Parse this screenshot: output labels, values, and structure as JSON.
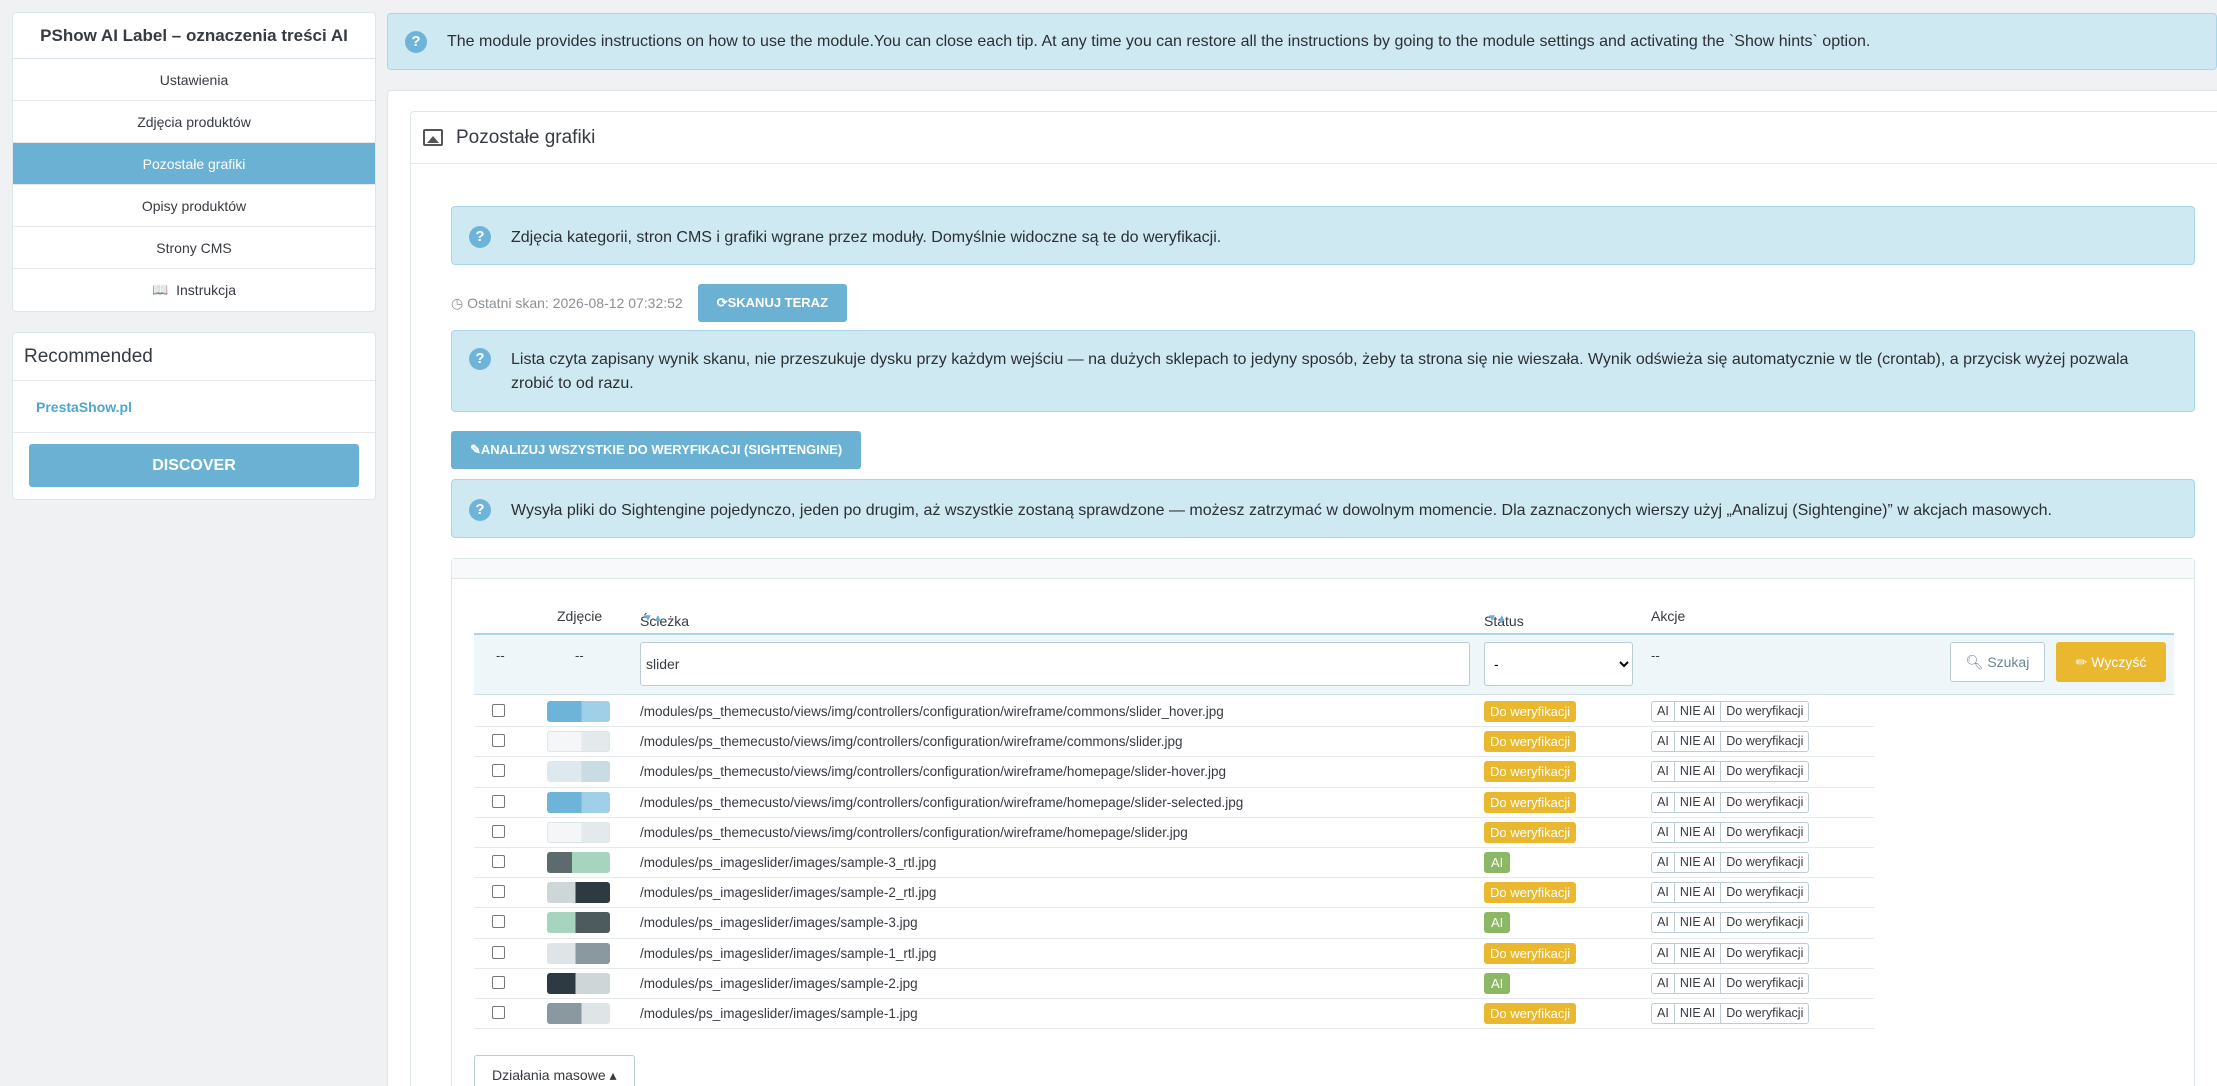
{
  "sidebar": {
    "title": "PShow AI Label – oznaczenia treści AI",
    "items": [
      {
        "label": "Ustawienia"
      },
      {
        "label": "Zdjęcia produktów"
      },
      {
        "label": "Pozostałe grafiki"
      },
      {
        "label": "Opisy produktów"
      },
      {
        "label": "Strony CMS"
      },
      {
        "label": "Instrukcja"
      }
    ],
    "active": "Pozostałe grafiki",
    "recommended_title": "Recommended",
    "recommended_link": "PrestaShow.pl",
    "discover_label": "DISCOVER"
  },
  "top_tip": "The module provides instructions on how to use the module.You can close each tip. At any time you can restore all the instructions by going to the module settings and activating the `Show hints` option.",
  "panel": {
    "title": "Pozostałe grafiki",
    "tip1": "Zdjęcia kategorii, stron CMS i grafiki wgrane przez moduły. Domyślnie widoczne są te do weryfikacji.",
    "last_scan": "Ostatni skan: 2026-08-12 07:32:52",
    "scan_button": "SKANUJ TERAZ",
    "tip2": "Lista czyta zapisany wynik skanu, nie przeszukuje dysku przy każdym wejściu — na dużych sklepach to jedyny sposób, żeby ta strona się nie wieszała. Wynik odświeża się automatycznie w tle (crontab), a przycisk wyżej pozwala zrobić to od razu.",
    "analyze_button": "ANALIZUJ WSZYSTKIE DO WERYFIKACJI (SIGHTENGINE)",
    "tip3": "Wysyła pliki do Sightengine pojedynczo, jeden po drugim, aż wszystkie zostaną sprawdzone — możesz zatrzymać w dowolnym momencie. Dla zaznaczonych wierszy użyj „Analizuj (Sightengine)” w akcjach masowych."
  },
  "table": {
    "headers": {
      "photo": "Zdjęcie",
      "path": "Ścieżka",
      "status": "Status",
      "actions": "Akcje"
    },
    "filter": {
      "dash1": "--",
      "dash2": "--",
      "path_value": "slider",
      "status_value": "-",
      "actions_dash": "--",
      "search_label": "Szukaj",
      "clear_label": "Wyczyść"
    },
    "action_labels": {
      "ai": "AI",
      "not_ai": "NIE AI",
      "verify": "Do weryfikacji"
    },
    "rows": [
      {
        "path": "/modules/ps_themecusto/views/img/controllers/configuration/wireframe/commons/slider_hover.jpg",
        "status": "Do weryfikacji",
        "status_color": "#eab82f"
      },
      {
        "path": "/modules/ps_themecusto/views/img/controllers/configuration/wireframe/commons/slider.jpg",
        "status": "Do weryfikacji",
        "status_color": "#eab82f"
      },
      {
        "path": "/modules/ps_themecusto/views/img/controllers/configuration/wireframe/homepage/slider-hover.jpg",
        "status": "Do weryfikacji",
        "status_color": "#eab82f"
      },
      {
        "path": "/modules/ps_themecusto/views/img/controllers/configuration/wireframe/homepage/slider-selected.jpg",
        "status": "Do weryfikacji",
        "status_color": "#eab82f"
      },
      {
        "path": "/modules/ps_themecusto/views/img/controllers/configuration/wireframe/homepage/slider.jpg",
        "status": "Do weryfikacji",
        "status_color": "#eab82f"
      },
      {
        "path": "/modules/ps_imageslider/images/sample-3_rtl.jpg",
        "status": "AI",
        "status_color": "#8cb764"
      },
      {
        "path": "/modules/ps_imageslider/images/sample-2_rtl.jpg",
        "status": "Do weryfikacji",
        "status_color": "#eab82f"
      },
      {
        "path": "/modules/ps_imageslider/images/sample-3.jpg",
        "status": "AI",
        "status_color": "#8cb764"
      },
      {
        "path": "/modules/ps_imageslider/images/sample-1_rtl.jpg",
        "status": "Do weryfikacji",
        "status_color": "#eab82f"
      },
      {
        "path": "/modules/ps_imageslider/images/sample-2.jpg",
        "status": "AI",
        "status_color": "#8cb764"
      },
      {
        "path": "/modules/ps_imageslider/images/sample-1.jpg",
        "status": "Do weryfikacji",
        "status_color": "#eab82f"
      }
    ],
    "bulk_label": "Działania masowe"
  },
  "colors": {
    "accent": "#6bb1d4",
    "warning": "#eab82f",
    "success": "#8cb764",
    "tip_bg": "#cfe9f3"
  }
}
